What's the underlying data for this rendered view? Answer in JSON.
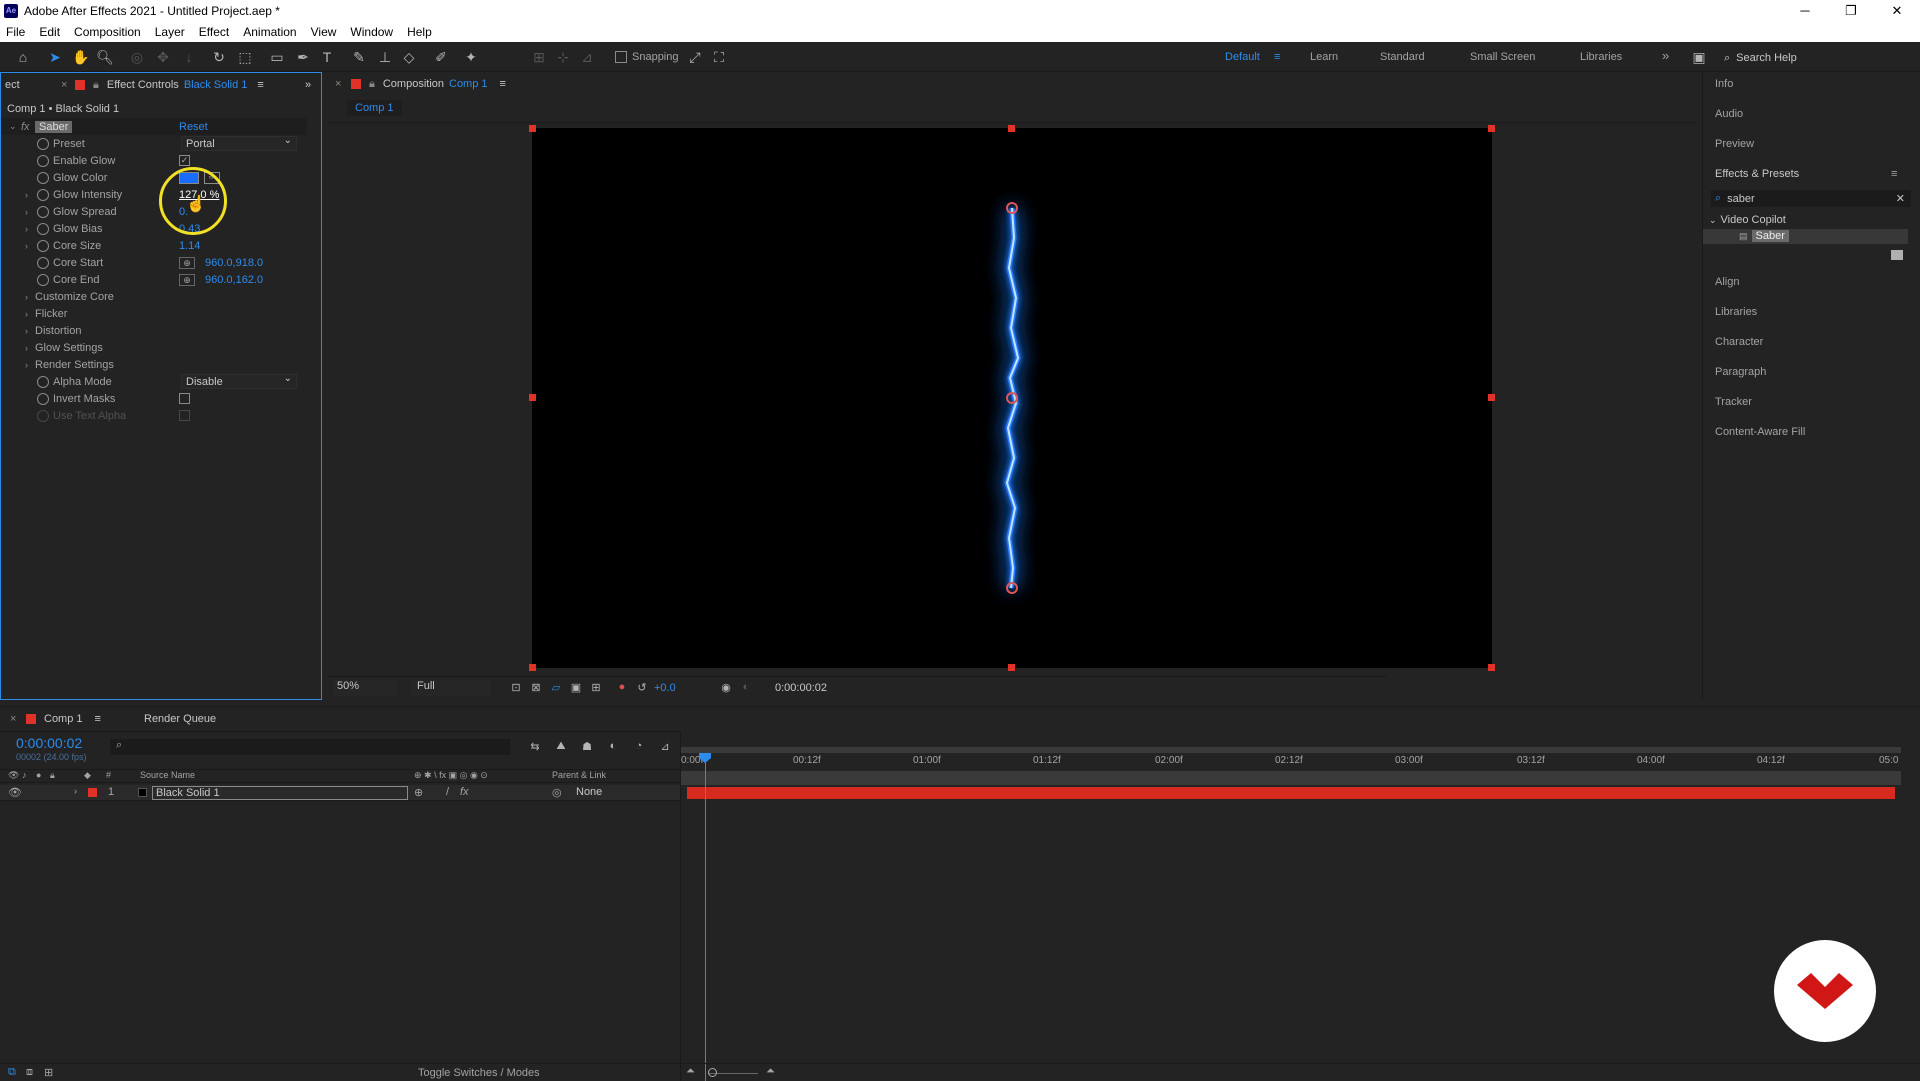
{
  "titlebar": {
    "app_icon": "Ae",
    "title": "Adobe After Effects 2021 - Untitled Project.aep *",
    "minimize": "─",
    "restore": "❐",
    "close": "✕"
  },
  "menu": [
    "File",
    "Edit",
    "Composition",
    "Layer",
    "Effect",
    "Animation",
    "View",
    "Window",
    "Help"
  ],
  "toolbar": {
    "snapping": "Snapping"
  },
  "workspaces": {
    "default": "Default",
    "learn": "Learn",
    "standard": "Standard",
    "small_screen": "Small Screen",
    "libraries": "Libraries",
    "search_help": "Search Help"
  },
  "effect_controls": {
    "left_tab": "ect",
    "tab_label": "Effect Controls",
    "tab_layer": "Black Solid 1",
    "breadcrumb": "Comp 1 • Black Solid 1",
    "effect_name": "Saber",
    "reset": "Reset",
    "preset_label": "Preset",
    "preset_value": "Portal",
    "enable_glow": "Enable Glow",
    "glow_color": "Glow Color",
    "glow_color_hex": "#1a6cff",
    "glow_intensity": "Glow Intensity",
    "glow_intensity_val": "127.0 %",
    "glow_spread": "Glow Spread",
    "glow_spread_val": "0.",
    "glow_bias": "Glow Bias",
    "glow_bias_val": "0.43",
    "core_size": "Core Size",
    "core_size_val": "1.14",
    "core_start": "Core Start",
    "core_start_val": "960.0,918.0",
    "core_end": "Core End",
    "core_end_val": "960.0,162.0",
    "customize_core": "Customize Core",
    "flicker": "Flicker",
    "distortion": "Distortion",
    "glow_settings": "Glow Settings",
    "render_settings": "Render Settings",
    "alpha_mode": "Alpha Mode",
    "alpha_mode_val": "Disable",
    "invert_masks": "Invert Masks",
    "use_text_alpha": "Use Text Alpha"
  },
  "composition": {
    "tab_label": "Composition",
    "tab_comp": "Comp 1",
    "sub_tab": "Comp 1",
    "zoom": "50%",
    "resolution": "Full",
    "exposure": "+0.0",
    "timecode": "0:00:00:02"
  },
  "right_panel": {
    "info": "Info",
    "audio": "Audio",
    "preview": "Preview",
    "effects_presets": "Effects & Presets",
    "search_value": "saber",
    "category": "Video Copilot",
    "result": "Saber",
    "align": "Align",
    "libraries": "Libraries",
    "character": "Character",
    "paragraph": "Paragraph",
    "tracker": "Tracker",
    "content_aware": "Content-Aware Fill"
  },
  "timeline": {
    "tab_comp": "Comp 1",
    "tab_render": "Render Queue",
    "timecode": "0:00:00:02",
    "frame_info": "00002 (24.00 fps)",
    "col_source": "Source Name",
    "col_parent": "Parent & Link",
    "layer_num": "1",
    "layer_name": "Black Solid 1",
    "parent_val": "None",
    "ruler": [
      "0:00f",
      "00:12f",
      "01:00f",
      "01:12f",
      "02:00f",
      "02:12f",
      "03:00f",
      "03:12f",
      "04:00f",
      "04:12f",
      "05:0"
    ],
    "toggle": "Toggle Switches / Modes"
  }
}
